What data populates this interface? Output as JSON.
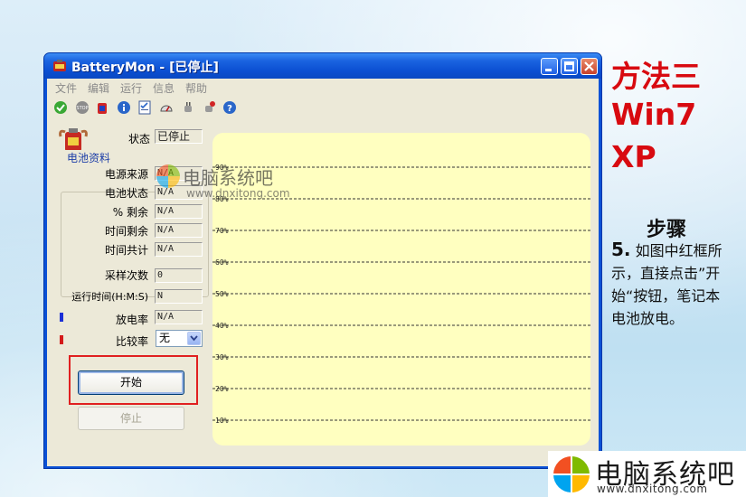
{
  "window": {
    "title": "BatteryMon - [已停止]",
    "menu": [
      "文件",
      "编辑",
      "运行",
      "信息",
      "帮助"
    ],
    "toolbar_icons": [
      "check-icon",
      "stop-icon",
      "battery-icon",
      "info-icon",
      "checklist-icon",
      "gauge-icon",
      "plug-icon",
      "plug-warning-icon",
      "help-icon"
    ]
  },
  "panel": {
    "status_label": "状态",
    "status_value": "已停止",
    "group_title": "电池资料",
    "rows": [
      {
        "label": "电源来源",
        "value": "N/A"
      },
      {
        "label": "电池状态",
        "value": "N/A"
      },
      {
        "label": "% 剩余",
        "value": "N/A"
      },
      {
        "label": "时间剩余",
        "value": "N/A"
      },
      {
        "label": "时间共计",
        "value": "N/A"
      }
    ],
    "samples_label": "采样次数",
    "samples_value": "0",
    "runtime_label": "运行时间(H:M:S)",
    "runtime_value": "N",
    "discharge_label": "放电率",
    "discharge_value": "N/A",
    "compare_label": "比较率",
    "compare_value": "无",
    "start_button": "开始",
    "stop_button": "停止",
    "discharge_color": "#1b2fd6",
    "compare_color": "#d41a1a"
  },
  "chart_data": {
    "type": "line",
    "y_ticks": [
      "90%",
      "80%",
      "70%",
      "60%",
      "50%",
      "40%",
      "30%",
      "20%",
      "10%"
    ],
    "y_values": [
      90,
      80,
      70,
      60,
      50,
      40,
      30,
      20,
      10
    ],
    "ylim": [
      0,
      100
    ],
    "series": [],
    "grid": true
  },
  "side": {
    "line1": "方法三",
    "line2": "Win7",
    "line3": "XP",
    "steps_title": "步骤",
    "step_num": "5.",
    "step_text": " 如图中红框所示，直接点击”开始“按钮，笔记本电池放电。",
    "accent": "#d80a10"
  },
  "watermark": {
    "name": "电脑系统吧",
    "url": "www.dnxitong.com"
  }
}
